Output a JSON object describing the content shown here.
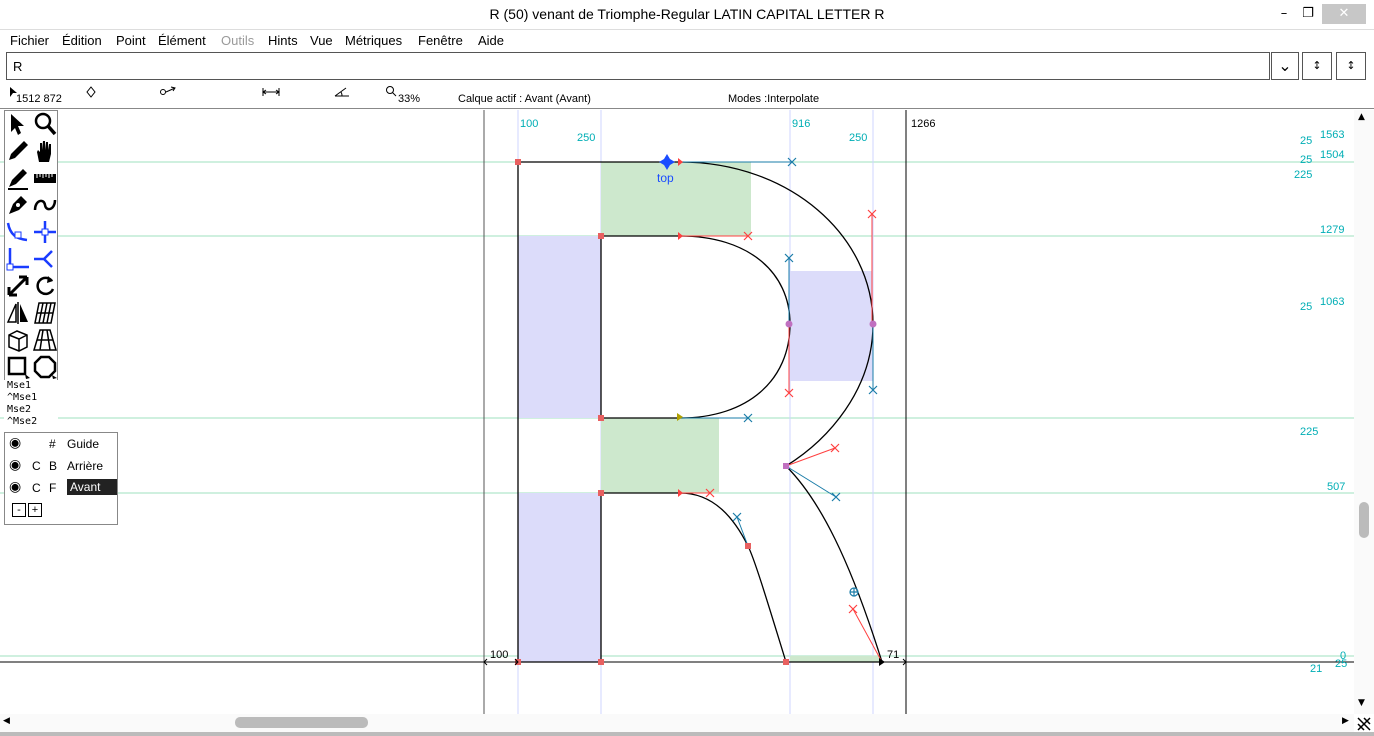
{
  "window": {
    "title": "R (50) venant de Triomphe-Regular LATIN CAPITAL LETTER R",
    "minimize": "–",
    "maximize": "❐",
    "close": "✕"
  },
  "menu": [
    {
      "label": "Fichier",
      "disabled": false
    },
    {
      "label": "Édition",
      "disabled": false
    },
    {
      "label": "Point",
      "disabled": false
    },
    {
      "label": "Élément",
      "disabled": false
    },
    {
      "label": "Outils",
      "disabled": true
    },
    {
      "label": "Hints",
      "disabled": false
    },
    {
      "label": "Vue",
      "disabled": false
    },
    {
      "label": "Métriques",
      "disabled": false
    },
    {
      "label": "Fenêtre",
      "disabled": false
    },
    {
      "label": "Aide",
      "disabled": false
    }
  ],
  "glyph_input": {
    "value": "R"
  },
  "controls": {
    "dropdown": "⌄",
    "prev": "↕",
    "next": "↕"
  },
  "infobar": {
    "coords": "1512 872",
    "zoom": "33%",
    "layer": "Calque actif : Avant (Avant)",
    "modes": "Modes :Interpolate"
  },
  "tools_icons": [
    "pointer-icon",
    "magnify-icon",
    "pencil-icon",
    "hand-icon",
    "pen-icon",
    "ruler-icon",
    "nib-icon",
    "spiro-icon",
    "curve-point-icon",
    "hv-point-icon",
    "corner-point-icon",
    "tangent-point-icon",
    "scale-icon",
    "rotate-icon",
    "flip-icon",
    "skew-icon",
    "3d-rotate-icon",
    "perspective-icon",
    "rectangle-icon",
    "polygon-icon"
  ],
  "mouse_hints": [
    "Mse1",
    "^Mse1",
    "Mse2",
    "^Mse2"
  ],
  "layers": [
    {
      "eye": "◉",
      "c": "",
      "b": "#",
      "name": "Guide",
      "selected": false
    },
    {
      "eye": "◉",
      "c": "C",
      "b": "B",
      "name": "Arrière",
      "selected": false
    },
    {
      "eye": "◉",
      "c": "C",
      "b": "F",
      "name": "Avant",
      "selected": true
    }
  ],
  "layer_buttons": {
    "minus": "-",
    "plus": "+"
  },
  "canvas": {
    "anchor_label": "top",
    "top_metrics": [
      "100",
      "250",
      "916",
      "250",
      "1266"
    ],
    "right_metrics": [
      {
        "left": "25",
        "right": "1563"
      },
      {
        "left": "25",
        "right": "1504"
      },
      {
        "left": "225",
        "right": ""
      },
      {
        "left": "",
        "right": "1279"
      },
      {
        "left": "25",
        "right": "1063"
      },
      {
        "left": "225",
        "right": ""
      },
      {
        "left": "",
        "right": "507"
      },
      {
        "left": "",
        "right": "0"
      }
    ],
    "baseline_labels": {
      "lsb": "100",
      "rsb": "71",
      "tail": "25",
      "tail2": "21"
    },
    "colors": {
      "guide": "#9fe0bf",
      "metric_text": "#00aeb5",
      "vhint": "#dcdcfa",
      "hhint": "#cde8cd",
      "point_red": "#ff4040",
      "handle_blue": "#1a7ca8",
      "anchor": "#1a4cff"
    }
  },
  "scrollbars": {
    "up": "▲",
    "down": "▼",
    "left": "◀",
    "right": "▶"
  }
}
